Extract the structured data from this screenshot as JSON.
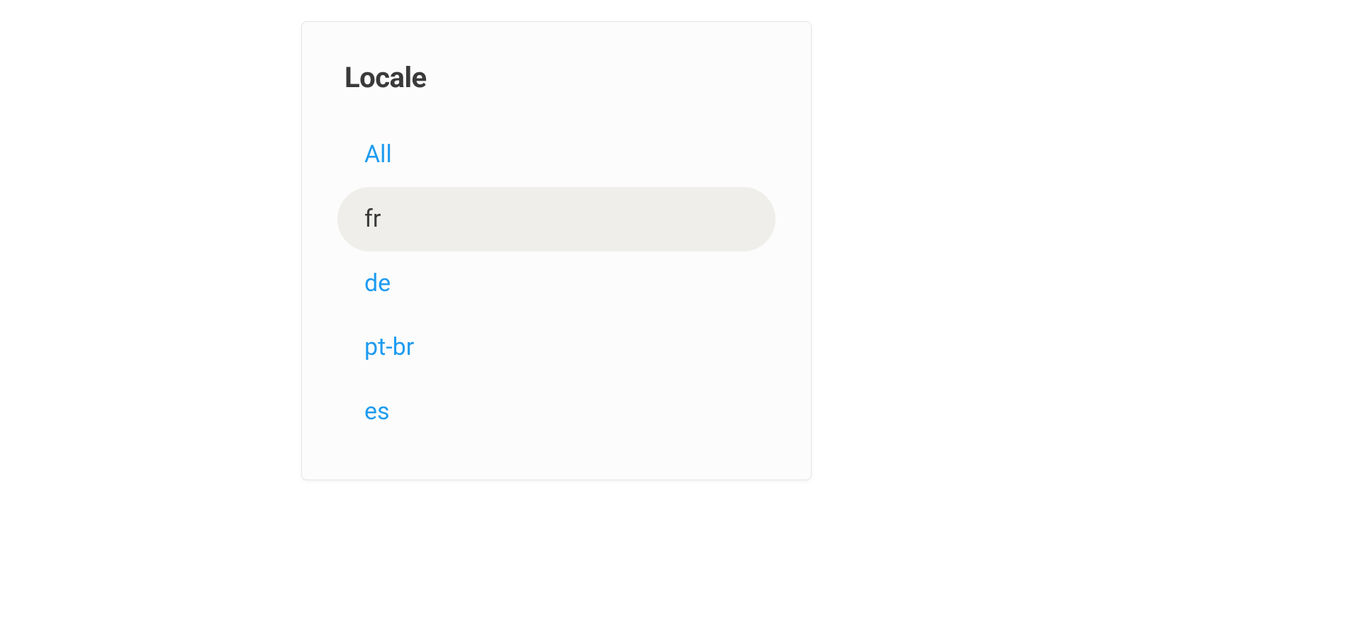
{
  "panel": {
    "title": "Locale",
    "items": [
      {
        "label": "All",
        "selected": false
      },
      {
        "label": "fr",
        "selected": true
      },
      {
        "label": "de",
        "selected": false
      },
      {
        "label": "pt-br",
        "selected": false
      },
      {
        "label": "es",
        "selected": false
      }
    ]
  }
}
